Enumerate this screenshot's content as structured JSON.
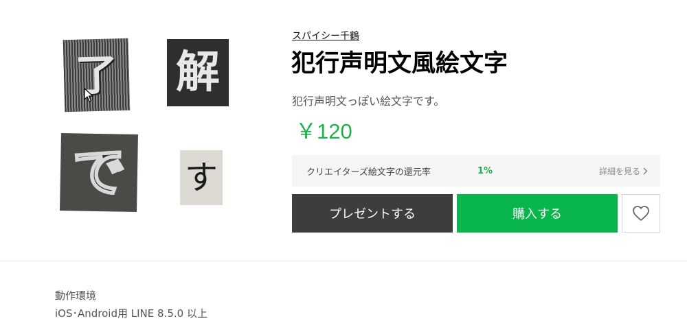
{
  "preview": {
    "tiles": [
      {
        "char": "了"
      },
      {
        "char": "解"
      },
      {
        "char": "で"
      },
      {
        "char": "す"
      }
    ]
  },
  "product": {
    "author": "スパイシー千鶴",
    "title": "犯行声明文風絵文字",
    "description": "犯行声明文っぽい絵文字です。",
    "price": "￥120"
  },
  "return_rate": {
    "label": "クリエイターズ絵文字の還元率",
    "value": "1%",
    "link": "詳細を見る",
    "link_icon": "chevron-right-icon"
  },
  "actions": {
    "gift_label": "プレゼントする",
    "buy_label": "購入する",
    "like_icon": "heart-icon"
  },
  "environment": {
    "title": "動作環境",
    "value": "iOS･Android用 LINE 8.5.0 以上"
  },
  "colors": {
    "accent_green": "#1eb24a",
    "buy_button": "#08b64b",
    "gift_button": "#3d3d3d"
  }
}
